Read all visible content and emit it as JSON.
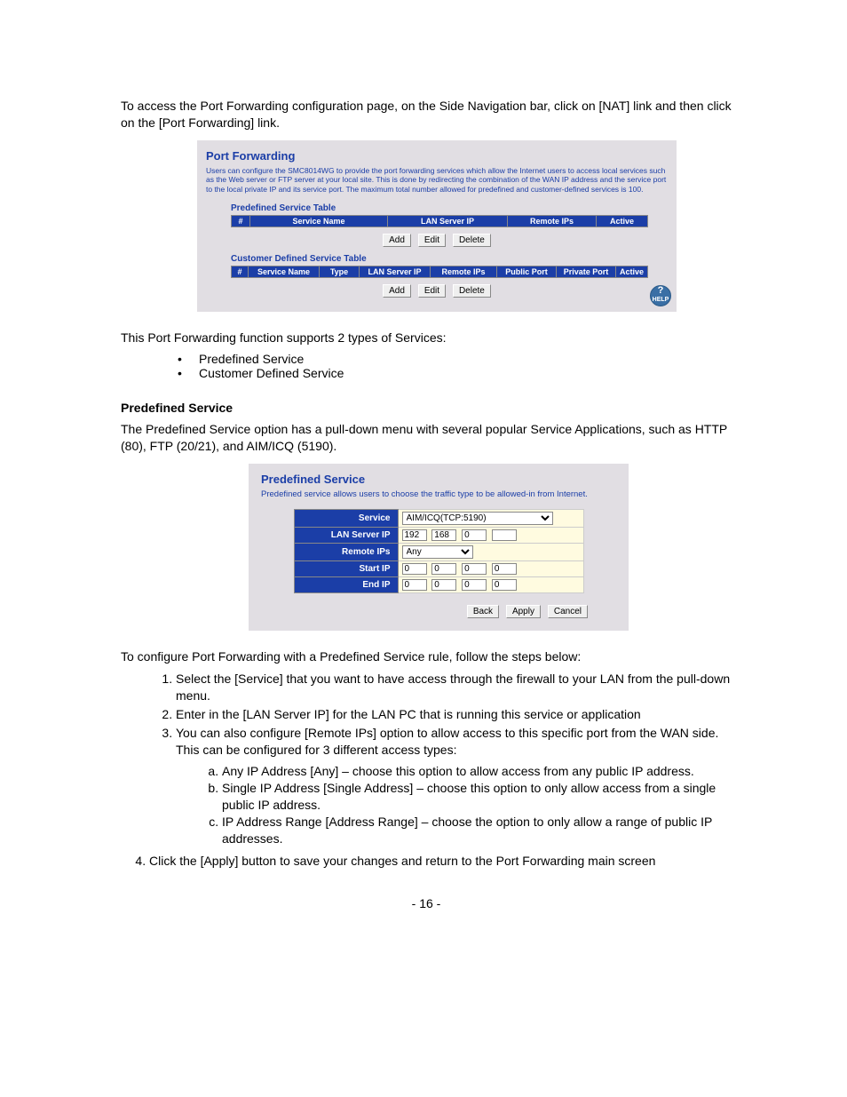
{
  "intro": "To access the Port Forwarding configuration page, on the Side Navigation bar, click on [NAT] link and then click on the [Port Forwarding] link.",
  "panel1": {
    "title": "Port Forwarding",
    "desc": "Users can configure the SMC8014WG to provide the port forwarding services which allow the Internet users to access local services such as the Web server or FTP server at your local site. This is done by redirecting the combination of the WAN IP address and the service port to the local private IP and its service port. The maximum total number allowed for predefined and customer-defined services is 100.",
    "predef_label": "Predefined Service Table",
    "predef_cols": {
      "c0": "#",
      "c1": "Service Name",
      "c2": "LAN Server IP",
      "c3": "Remote IPs",
      "c4": "Active"
    },
    "cust_label": "Customer Defined Service Table",
    "cust_cols": {
      "c0": "#",
      "c1": "Service Name",
      "c2": "Type",
      "c3": "LAN Server IP",
      "c4": "Remote IPs",
      "c5": "Public Port",
      "c6": "Private Port",
      "c7": "Active"
    },
    "btn_add": "Add",
    "btn_edit": "Edit",
    "btn_delete": "Delete",
    "help": "HELP"
  },
  "mid1": "This Port Forwarding function supports 2 types of Services:",
  "bullets": {
    "b0": "Predefined Service",
    "b1": "Customer Defined Service"
  },
  "section_title": "Predefined Service",
  "section_desc": "The Predefined Service option has a pull-down menu with several popular Service Applications, such as HTTP (80), FTP (20/21), and AIM/ICQ (5190).",
  "panel2": {
    "title": "Predefined Service",
    "desc": "Predefined service allows users to choose the traffic type to be allowed-in from Internet.",
    "labels": {
      "service": "Service",
      "lan": "LAN Server IP",
      "remote": "Remote IPs",
      "start": "Start IP",
      "end": "End IP"
    },
    "service_value": "AIM/ICQ(TCP:5190)",
    "lan": {
      "a": "192",
      "b": "168",
      "c": "0",
      "d": ""
    },
    "remote_value": "Any",
    "start": {
      "a": "0",
      "b": "0",
      "c": "0",
      "d": "0"
    },
    "end": {
      "a": "0",
      "b": "0",
      "c": "0",
      "d": "0"
    },
    "btn_back": "Back",
    "btn_apply": "Apply",
    "btn_cancel": "Cancel"
  },
  "mid2": "To configure Port Forwarding with a Predefined Service rule, follow the steps below:",
  "steps": {
    "s1": "Select the [Service] that you want to have access through the firewall to your LAN from the pull-down menu.",
    "s2": "Enter in the [LAN Server IP] for the LAN PC that is running this service or application",
    "s3": "You can also configure [Remote IPs] option to allow access to this specific port from the WAN side. This can be configured for 3 different access types:",
    "s3a": "Any IP Address [Any] – choose this option to allow access from any public IP address.",
    "s3b": "Single IP Address [Single Address] – choose this option to only allow access from a single public IP address.",
    "s3c": "IP Address Range [Address Range] – choose the option to only allow a range of public IP addresses.",
    "s4": "Click the [Apply] button to save your changes and return to the Port Forwarding main screen"
  },
  "pagenum": "- 16 -"
}
